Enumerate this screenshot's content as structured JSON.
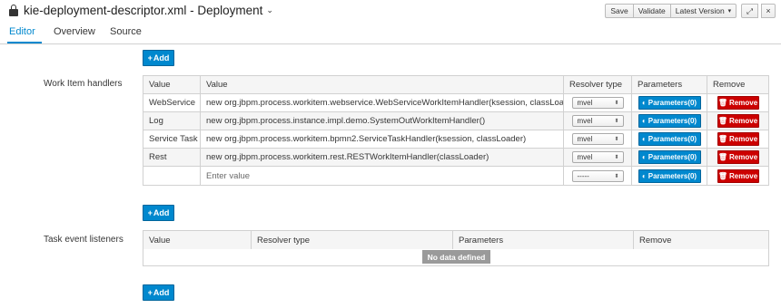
{
  "header": {
    "title": "kie-deployment-descriptor.xml - Deployment",
    "caret": "⌄",
    "save": "Save",
    "validate": "Validate",
    "latest_version": "Latest Version",
    "version_caret": "▾",
    "expand_glyph": "⤢",
    "close_glyph": "×"
  },
  "tabs": [
    "Editor",
    "Overview",
    "Source"
  ],
  "add_label": "Add",
  "work_item": {
    "label": "Work Item handlers",
    "headers": [
      "Value",
      "Value",
      "Resolver type",
      "Parameters",
      "Remove"
    ],
    "rows": [
      {
        "name": "WebService",
        "value": "new org.jbpm.process.workitem.webservice.WebServiceWorkItemHandler(ksession, classLoader)",
        "resolver": "mvel",
        "params": "Parameters(0)",
        "remove": "Remove"
      },
      {
        "name": "Log",
        "value": "new org.jbpm.process.instance.impl.demo.SystemOutWorkItemHandler()",
        "resolver": "mvel",
        "params": "Parameters(0)",
        "remove": "Remove"
      },
      {
        "name": "Service Task",
        "value": "new org.jbpm.process.workitem.bpmn2.ServiceTaskHandler(ksession, classLoader)",
        "resolver": "mvel",
        "params": "Parameters(0)",
        "remove": "Remove"
      },
      {
        "name": "Rest",
        "value": "new org.jbpm.process.workitem.rest.RESTWorkItemHandler(classLoader)",
        "resolver": "mvel",
        "params": "Parameters(0)",
        "remove": "Remove"
      },
      {
        "name": "",
        "value": "Enter value",
        "resolver": "-----",
        "params": "Parameters(0)",
        "remove": "Remove"
      }
    ]
  },
  "task_event": {
    "label": "Task event listeners",
    "headers": [
      "Value",
      "Resolver type",
      "Parameters",
      "Remove"
    ],
    "empty_text": "No data defined"
  },
  "colors": {
    "accent": "#0088ce",
    "danger": "#cc0000",
    "border": "#d1d1d1",
    "nodata": "#9a9a9a"
  },
  "icons": {
    "lock": "lock-icon",
    "plus": "plus-icon",
    "params": "half-circle-icon",
    "trash": "trash-icon"
  }
}
